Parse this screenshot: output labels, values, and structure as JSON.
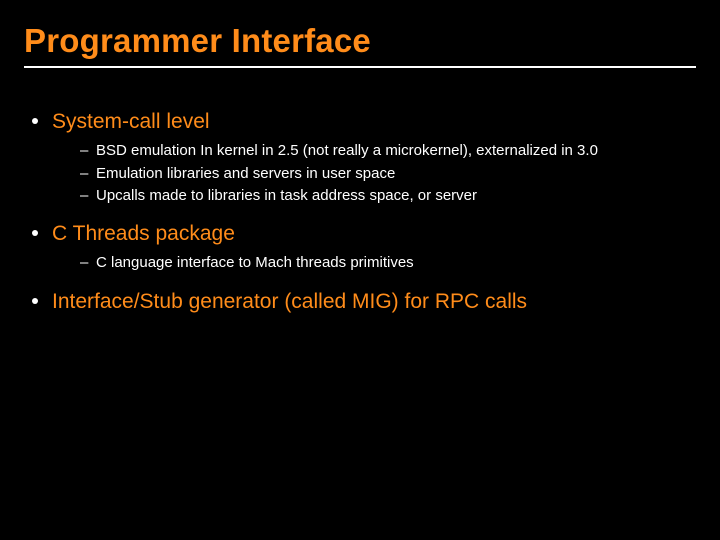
{
  "title": "Programmer Interface",
  "items": [
    {
      "label": "System-call level",
      "sub": [
        "BSD emulation In kernel in 2.5 (not really a microkernel), externalized in 3.0",
        "Emulation libraries and servers in user space",
        "Upcalls made to libraries in task address space, or server"
      ]
    },
    {
      "label": "C Threads package",
      "sub": [
        "C language interface to Mach threads primitives"
      ]
    },
    {
      "label": "Interface/Stub generator (called MIG) for RPC calls",
      "sub": []
    }
  ]
}
